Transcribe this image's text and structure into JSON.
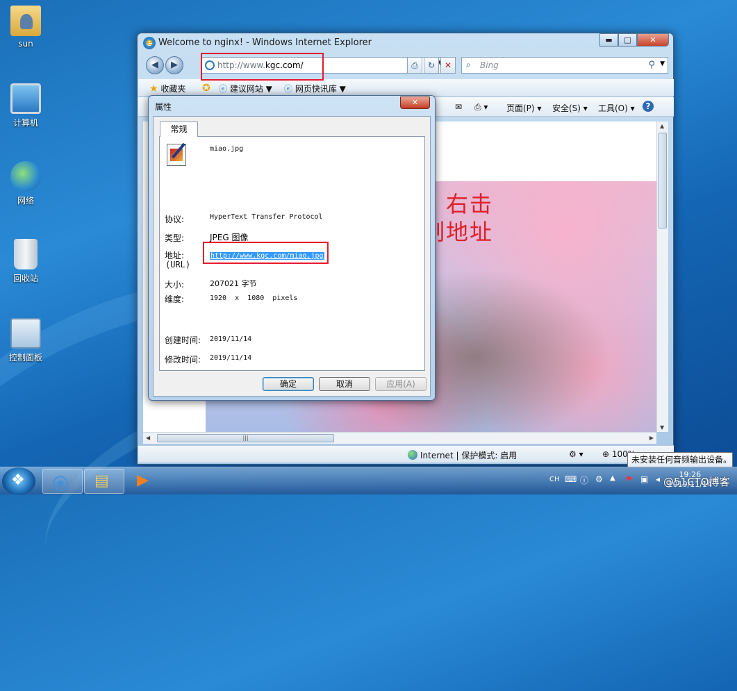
{
  "desktop": {
    "icons": [
      {
        "label": "sun",
        "icon": "user-folder-icon"
      },
      {
        "label": "计算机",
        "icon": "computer-icon"
      },
      {
        "label": "网络",
        "icon": "network-icon"
      },
      {
        "label": "回收站",
        "icon": "recycle-bin-icon"
      },
      {
        "label": "控制面板",
        "icon": "control-panel-icon"
      }
    ]
  },
  "browser": {
    "title": "Welcome to nginx! - Windows Internet Explorer",
    "window_buttons": {
      "minimize": "▬",
      "maximize": "□",
      "close": "✕"
    },
    "address": {
      "prefix": "http://www.",
      "host": "kgc.com/"
    },
    "search_placeholder": "Bing",
    "favorites": {
      "label": "收藏夹",
      "suggested_sites": "建议网站 ▼",
      "web_slice": "网页快讯库 ▼"
    },
    "commands": {
      "page": "页面(P) ▾",
      "safety": "安全(S) ▾",
      "tools": "工具(O) ▾",
      "help": "?"
    },
    "annotation": "访问网址，右击图片，复制地址",
    "scroll_thumb": "|||",
    "status": {
      "zone": "Internet | 保护模式: 启用",
      "zoom": "100%"
    }
  },
  "properties_dialog": {
    "title": "属性",
    "close": "✕",
    "tab": "常规",
    "filename": "miao.jpg",
    "protocol_label": "协议:",
    "protocol_value": "HyperText Transfer Protocol",
    "type_label": "类型:",
    "type_value": "JPEG 图像",
    "address_label": "地址:",
    "address_sub_label": "(URL)",
    "address_value": "http://www.kgc.com/miao.jpg",
    "size_label": "大小:",
    "size_value": "207021 字节",
    "dimensions_label": "维度:",
    "dimensions_value": "1920  x  1080  pixels",
    "created_label": "创建时间:",
    "created_value": "2019/11/14",
    "modified_label": "修改时间:",
    "modified_value": "2019/11/14",
    "ok_button": "确定",
    "cancel_button": "取消",
    "apply_button": "应用(A)"
  },
  "taskbar": {
    "lang": "CH",
    "time": "19:26",
    "date": "2019/11/14",
    "tooltip": "未安装任何音频输出设备。",
    "watermark": "@51CTO博客"
  }
}
